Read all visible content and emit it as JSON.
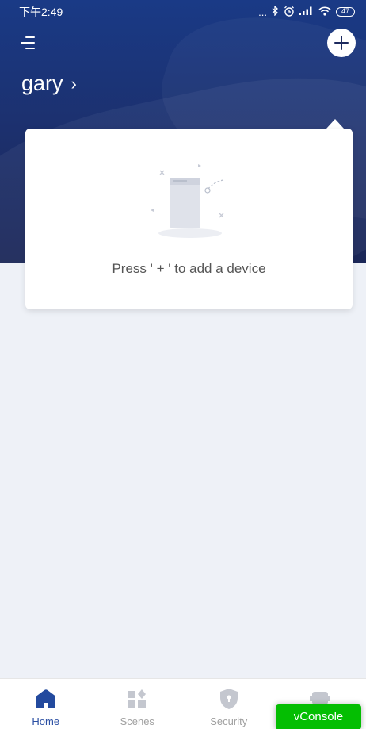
{
  "status_bar": {
    "time": "下午2:49",
    "dots": "...",
    "battery": "47"
  },
  "header": {
    "home_name": "gary",
    "chevron": "›"
  },
  "empty_state": {
    "text": "Press ' + ' to add a device"
  },
  "tabs": [
    {
      "label": "Home",
      "icon": "home-icon",
      "active": true
    },
    {
      "label": "Scenes",
      "icon": "scenes-icon",
      "active": false
    },
    {
      "label": "Security",
      "icon": "shield-icon",
      "active": false
    },
    {
      "label": "",
      "icon": "robot-icon",
      "active": false
    }
  ],
  "vconsole": {
    "label": "vConsole"
  },
  "colors": {
    "header_blue": "#1c2f6b",
    "accent_blue": "#2b4fa3",
    "vconsole_green": "#04be02",
    "page_bg": "#eef1f7"
  }
}
